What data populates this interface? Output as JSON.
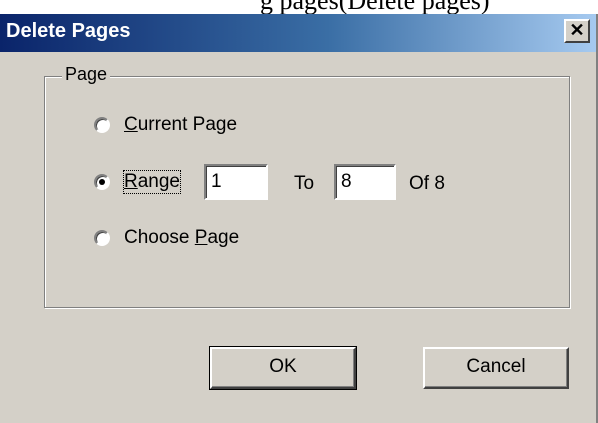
{
  "top_caption": "g pages(Delete pages)",
  "window": {
    "title": "Delete Pages",
    "close_glyph": "✕"
  },
  "group": {
    "label": "Page"
  },
  "options": {
    "current_page": {
      "label": "Current Page",
      "accel": "C",
      "rest": "urrent Page",
      "checked": false
    },
    "range": {
      "label": "Range",
      "accel": "R",
      "rest": "ange",
      "checked": true
    },
    "choose_page": {
      "label": "Choose Page",
      "prefix": "Choose ",
      "accel": "P",
      "rest": "age",
      "checked": false
    }
  },
  "range_fields": {
    "from_value": "1",
    "to_label": "To",
    "to_value": "8",
    "of_label": "Of 8"
  },
  "buttons": {
    "ok_label": "OK",
    "cancel_label": "Cancel"
  }
}
